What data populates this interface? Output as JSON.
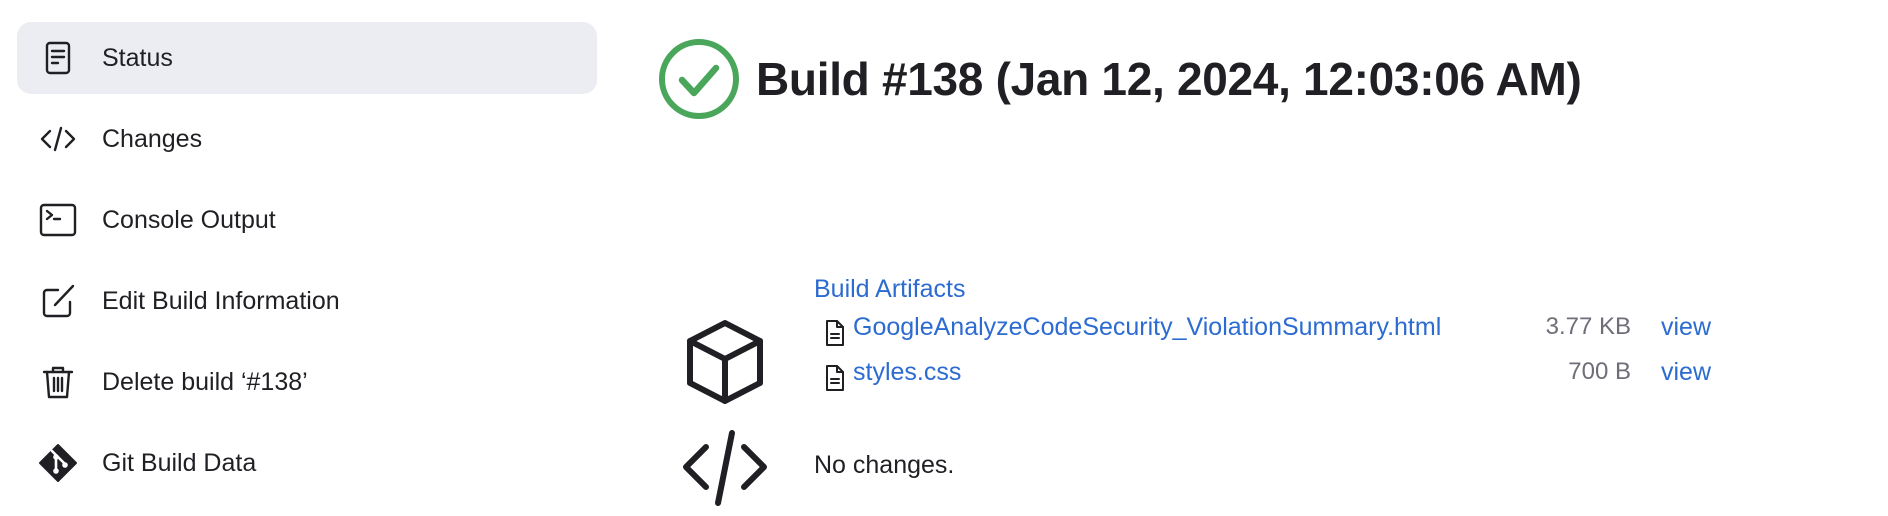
{
  "sidebar": {
    "items": [
      {
        "label": "Status",
        "icon": "status-document-icon",
        "active": true
      },
      {
        "label": "Changes",
        "icon": "code-brackets-icon",
        "active": false
      },
      {
        "label": "Console Output",
        "icon": "terminal-icon",
        "active": false
      },
      {
        "label": "Edit Build Information",
        "icon": "edit-icon",
        "active": false
      },
      {
        "label": "Delete build ‘#138’",
        "icon": "trash-icon",
        "active": false
      },
      {
        "label": "Git Build Data",
        "icon": "git-icon",
        "active": false
      }
    ]
  },
  "main": {
    "title": "Build #138 (Jan 12, 2024, 12:03:06 AM)",
    "status_icon": "success-check-icon",
    "status_color": "#4aa65a",
    "artifacts": {
      "heading": "Build Artifacts",
      "icon": "package-icon",
      "files": [
        {
          "name": "GoogleAnalyzeCodeSecurity_ViolationSummary.html",
          "size": "3.77 KB",
          "action": "view"
        },
        {
          "name": "styles.css",
          "size": "700 B",
          "action": "view"
        }
      ]
    },
    "changes": {
      "icon": "code-brackets-icon",
      "text": "No changes."
    }
  },
  "colors": {
    "link": "#2c6bd0",
    "active_bg": "#ecedf2",
    "text": "#1f1f24",
    "muted": "#6e6e78"
  }
}
